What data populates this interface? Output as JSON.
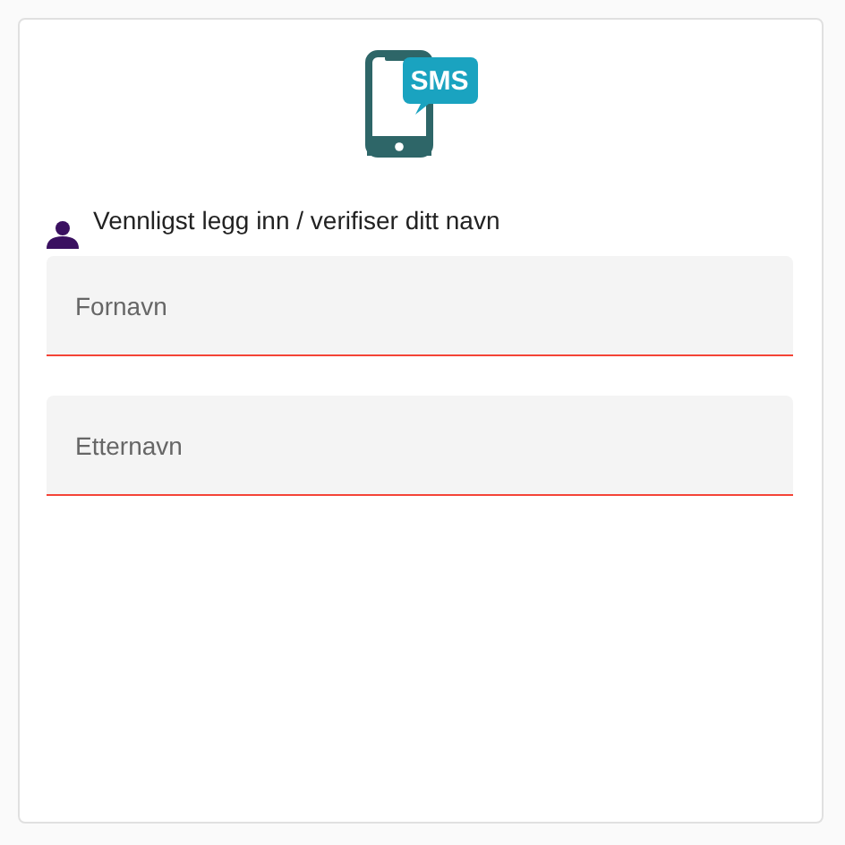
{
  "logo": {
    "badge": "SMS"
  },
  "prompt": "Vennligst legg inn / verifiser ditt navn",
  "fields": [
    {
      "placeholder": "Fornavn",
      "invalid": true
    },
    {
      "placeholder": "Etternavn",
      "invalid": true
    }
  ]
}
